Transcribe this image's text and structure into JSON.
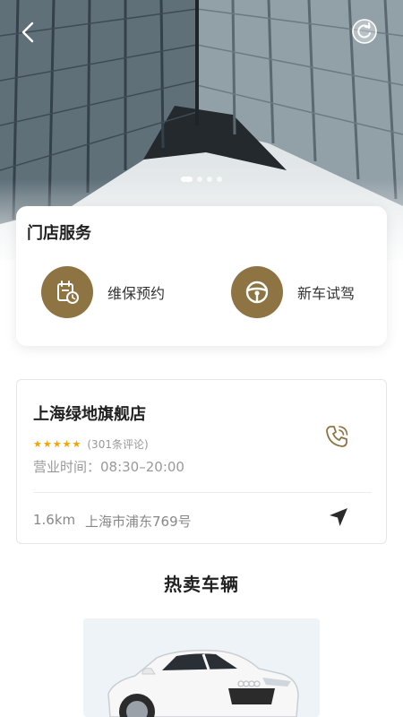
{
  "hero": {
    "carousel_total": 4,
    "carousel_active": 1
  },
  "services": {
    "title": "门店服务",
    "items": [
      {
        "label": "维保预约",
        "icon": "calendar-clock-icon"
      },
      {
        "label": "新车试驾",
        "icon": "steering-wheel-icon"
      }
    ]
  },
  "store": {
    "name": "上海绿地旗舰店",
    "rating": 5,
    "reviews": "(301条评论)",
    "hours": "营业时间：08:30–20:00",
    "distance": "1.6km",
    "address": "上海市浦东769号"
  },
  "hot": {
    "title": "热卖车辆"
  },
  "colors": {
    "accent": "#8e7443",
    "star": "#f0a500"
  }
}
